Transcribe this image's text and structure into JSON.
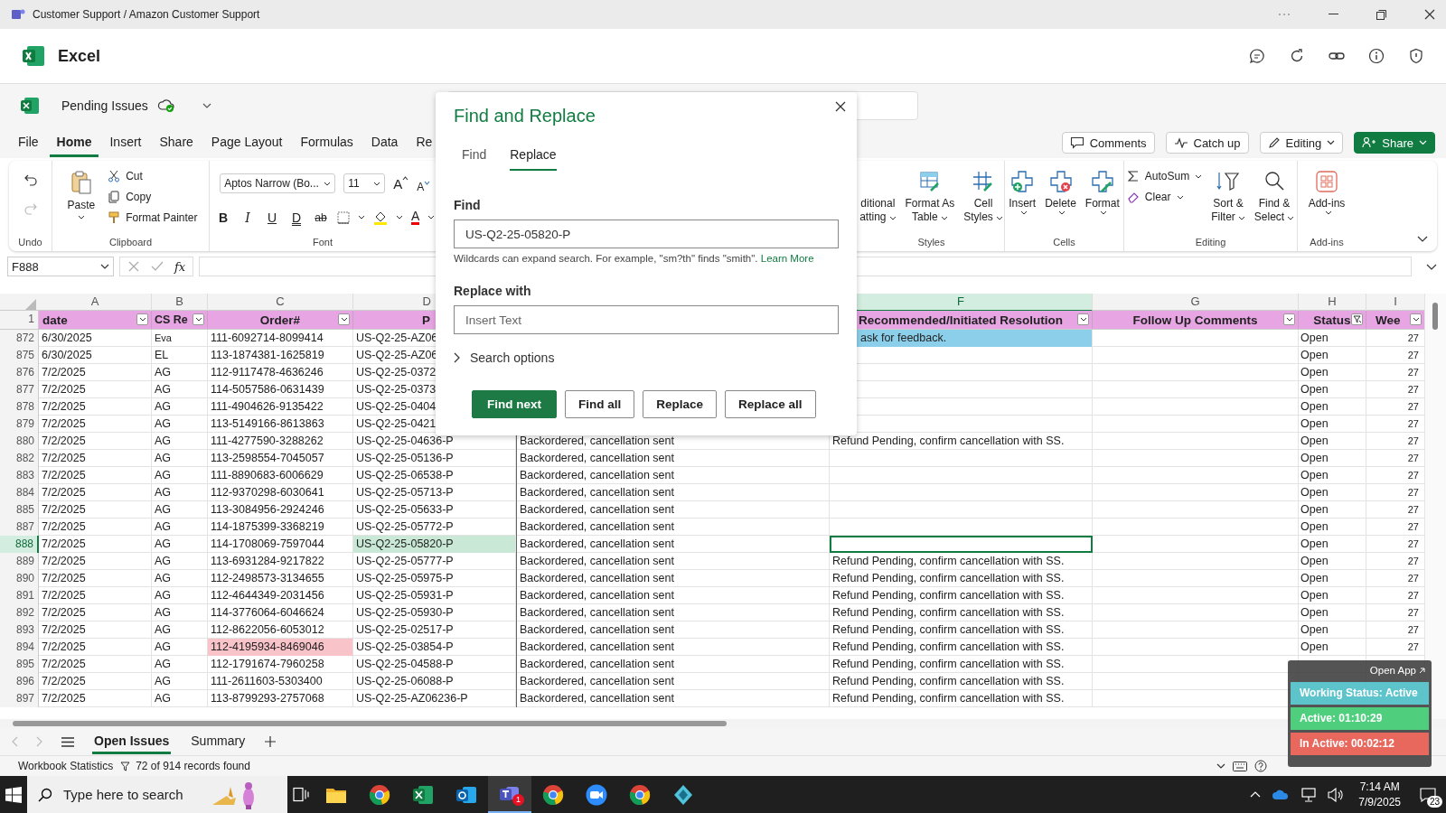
{
  "window": {
    "title": "Customer Support / Amazon Customer Support"
  },
  "app": {
    "name": "Excel"
  },
  "document": {
    "name": "Pending Issues"
  },
  "menu_tabs": [
    {
      "label": "File",
      "selected": false
    },
    {
      "label": "Home",
      "selected": true
    },
    {
      "label": "Insert",
      "selected": false
    },
    {
      "label": "Share",
      "selected": false
    },
    {
      "label": "Page Layout",
      "selected": false
    },
    {
      "label": "Formulas",
      "selected": false
    },
    {
      "label": "Data",
      "selected": false
    },
    {
      "label": "Re",
      "selected": false
    }
  ],
  "header_buttons": [
    {
      "label": "Comments",
      "kind": "comments"
    },
    {
      "label": "Catch up",
      "kind": "catchup"
    },
    {
      "label": "Editing",
      "kind": "editing"
    },
    {
      "label": "Share",
      "kind": "share"
    }
  ],
  "ribbon": {
    "undo": {
      "group": "Undo"
    },
    "clipboard": {
      "group": "Clipboard",
      "paste": "Paste",
      "commands": [
        "Cut",
        "Copy",
        "Format Painter"
      ]
    },
    "font": {
      "group": "Font",
      "family": "Aptos Narrow (Bo...",
      "size": "11",
      "size_buttons": [
        "A",
        "A"
      ],
      "format_buttons": [
        "B",
        "I",
        "U",
        "D",
        "ab"
      ],
      "color_button": "A"
    },
    "styles": {
      "group": "Styles",
      "commands": [
        {
          "line1": "ditional",
          "line2": "atting"
        },
        {
          "line1": "Format As",
          "line2": "Table"
        },
        {
          "line1": "Cell",
          "line2": "Styles"
        }
      ]
    },
    "cells": {
      "group": "Cells",
      "commands": [
        "Insert",
        "Delete",
        "Format"
      ]
    },
    "editing": {
      "group": "Editing",
      "small": [
        "AutoSum",
        "Clear"
      ],
      "large": [
        {
          "line1": "Sort &",
          "line2": "Filter"
        },
        {
          "line1": "Find &",
          "line2": "Select"
        }
      ]
    },
    "addins": {
      "group": "Add-ins",
      "command": "Add-ins"
    }
  },
  "formula_bar": {
    "cell": "F888",
    "function_label": "fx"
  },
  "columns": [
    {
      "letter": "A",
      "header": "date",
      "filtered": false,
      "selected": false
    },
    {
      "letter": "B",
      "header": "CS Re",
      "filtered": false,
      "selected": false
    },
    {
      "letter": "C",
      "header": "Order#",
      "filtered": false,
      "selected": false
    },
    {
      "letter": "D",
      "header": "P",
      "selected": false
    },
    {},
    {
      "letter": "F",
      "header": "Recommended/Initiated Resolution",
      "filtered": false,
      "selected": true
    },
    {
      "letter": "G",
      "header": "Follow Up Comments",
      "filtered": false,
      "selected": false
    },
    {
      "letter": "H",
      "header": "Status",
      "filtered": true,
      "selected": false
    },
    {
      "letter": "I",
      "header": "Wee",
      "filtered": false,
      "selected": false
    }
  ],
  "header_row": {
    "number": "1"
  },
  "rows": [
    {
      "number": "872",
      "selected": false,
      "cells": [
        "6/30/2025",
        "Eva",
        "111-6092714-8099414",
        "US-Q2-25-AZ06",
        null,
        {
          "text": "ask for feedback.",
          "color": "#8ccfea"
        },
        null,
        "Open",
        "27"
      ]
    },
    {
      "number": "875",
      "selected": false,
      "cells": [
        "6/30/2025",
        "EL",
        "113-1874381-1625819",
        "US-Q2-25-AZ06",
        null,
        null,
        null,
        "Open",
        "27"
      ]
    },
    {
      "number": "876",
      "selected": false,
      "cells": [
        "7/2/2025",
        "AG",
        "112-9117478-4636246",
        "US-Q2-25-0372",
        null,
        null,
        null,
        "Open",
        "27"
      ]
    },
    {
      "number": "877",
      "selected": false,
      "cells": [
        "7/2/2025",
        "AG",
        "114-5057586-0631439",
        "US-Q2-25-0373",
        null,
        null,
        null,
        "Open",
        "27"
      ]
    },
    {
      "number": "878",
      "selected": false,
      "cells": [
        "7/2/2025",
        "AG",
        "111-4904626-9135422",
        "US-Q2-25-0404",
        null,
        null,
        null,
        "Open",
        "27"
      ]
    },
    {
      "number": "879",
      "selected": false,
      "cells": [
        "7/2/2025",
        "AG",
        "113-5149166-8613863",
        "US-Q2-25-0421",
        null,
        null,
        null,
        "Open",
        "27"
      ]
    },
    {
      "number": "880",
      "selected": false,
      "cells": [
        "7/2/2025",
        "AG",
        "111-4277590-3288262",
        "US-Q2-25-04636-P",
        "Backordered, cancellation sent",
        "Refund Pending, confirm cancellation with SS.",
        null,
        "Open",
        "27"
      ]
    },
    {
      "number": "882",
      "selected": false,
      "cells": [
        "7/2/2025",
        "AG",
        "113-2598554-7045057",
        "US-Q2-25-05136-P",
        "Backordered, cancellation sent",
        null,
        null,
        "Open",
        "27"
      ]
    },
    {
      "number": "883",
      "selected": false,
      "cells": [
        "7/2/2025",
        "AG",
        "111-8890683-6006629",
        "US-Q2-25-06538-P",
        "Backordered, cancellation sent",
        null,
        null,
        "Open",
        "27"
      ]
    },
    {
      "number": "884",
      "selected": false,
      "cells": [
        "7/2/2025",
        "AG",
        "112-9370298-6030641",
        "US-Q2-25-05713-P",
        "Backordered, cancellation sent",
        null,
        null,
        "Open",
        "27"
      ]
    },
    {
      "number": "885",
      "selected": false,
      "cells": [
        "7/2/2025",
        "AG",
        "113-3084956-2924246",
        "US-Q2-25-05633-P",
        "Backordered, cancellation sent",
        null,
        null,
        "Open",
        "27"
      ]
    },
    {
      "number": "887",
      "selected": false,
      "cells": [
        "7/2/2025",
        "AG",
        "114-1875399-3368219",
        "US-Q2-25-05772-P",
        "Backordered, cancellation sent",
        null,
        null,
        "Open",
        "27"
      ]
    },
    {
      "number": "888",
      "selected": true,
      "cells": [
        "7/2/2025",
        "AG",
        "114-1708069-7597044",
        {
          "text": "US-Q2-25-05820-P",
          "color": "#c9e9d6"
        },
        "Backordered, cancellation sent",
        null,
        null,
        "Open",
        "27"
      ]
    },
    {
      "number": "889",
      "selected": false,
      "cells": [
        "7/2/2025",
        "AG",
        "113-6931284-9217822",
        "US-Q2-25-05777-P",
        "Backordered, cancellation sent",
        "Refund Pending, confirm cancellation with SS.",
        null,
        "Open",
        "27"
      ]
    },
    {
      "number": "890",
      "selected": false,
      "cells": [
        "7/2/2025",
        "AG",
        "112-2498573-3134655",
        "US-Q2-25-05975-P",
        "Backordered, cancellation sent",
        "Refund Pending, confirm cancellation with SS.",
        null,
        "Open",
        "27"
      ]
    },
    {
      "number": "891",
      "selected": false,
      "cells": [
        "7/2/2025",
        "AG",
        "112-4644349-2031456",
        "US-Q2-25-05931-P",
        "Backordered, cancellation sent",
        "Refund Pending, confirm cancellation with SS.",
        null,
        "Open",
        "27"
      ]
    },
    {
      "number": "892",
      "selected": false,
      "cells": [
        "7/2/2025",
        "AG",
        "114-3776064-6046624",
        "US-Q2-25-05930-P",
        "Backordered, cancellation sent",
        "Refund Pending, confirm cancellation with SS.",
        null,
        "Open",
        "27"
      ]
    },
    {
      "number": "893",
      "selected": false,
      "cells": [
        "7/2/2025",
        "AG",
        "112-8622056-6053012",
        "US-Q2-25-02517-P",
        "Backordered, cancellation sent",
        "Refund Pending, confirm cancellation with SS.",
        null,
        "Open",
        "27"
      ]
    },
    {
      "number": "894",
      "selected": false,
      "cells": [
        "7/2/2025",
        "AG",
        {
          "text": "112-4195934-8469046",
          "color": "#f8c3c9"
        },
        "US-Q2-25-03854-P",
        "Backordered, cancellation sent",
        "Refund Pending, confirm cancellation with SS.",
        null,
        "Open",
        "27"
      ]
    },
    {
      "number": "895",
      "selected": false,
      "cells": [
        "7/2/2025",
        "AG",
        "112-1791674-7960258",
        "US-Q2-25-04588-P",
        "Backordered, cancellation sent",
        "Refund Pending, confirm cancellation with SS.",
        null,
        null,
        null
      ]
    },
    {
      "number": "896",
      "selected": false,
      "cells": [
        "7/2/2025",
        "AG",
        "111-2611603-5303400",
        "US-Q2-25-06088-P",
        "Backordered, cancellation sent",
        "Refund Pending, confirm cancellation with SS.",
        null,
        null,
        null
      ]
    },
    {
      "number": "897",
      "selected": false,
      "cells": [
        "7/2/2025",
        "AG",
        "113-8799293-2757068",
        "US-Q2-25-AZ06236-P",
        "Backordered, cancellation sent",
        "Refund Pending, confirm cancellation with SS.",
        null,
        null,
        null
      ]
    }
  ],
  "sheet_tabs": [
    {
      "label": "Open Issues",
      "selected": true
    },
    {
      "label": "Summary",
      "selected": false
    }
  ],
  "status_bar": {
    "left": "Workbook Statistics",
    "filter_count": "72 of 914 records found"
  },
  "dialog": {
    "title": "Find and Replace",
    "tabs": [
      {
        "label": "Find",
        "selected": false
      },
      {
        "label": "Replace",
        "selected": true
      }
    ],
    "find_label": "Find",
    "find_value": "US-Q2-25-05820-P",
    "hint": "Wildcards can expand search. For example, \"sm?th\" finds \"smith\".",
    "hint_link": "Learn More",
    "replace_label": "Replace with",
    "replace_placeholder": "Insert Text",
    "options": "Search options",
    "buttons": [
      {
        "label": "Find next",
        "kind": "primary"
      },
      {
        "label": "Find all",
        "kind": "secondary"
      },
      {
        "label": "Replace",
        "kind": "secondary"
      },
      {
        "label": "Replace all",
        "kind": "secondary"
      }
    ]
  },
  "tracker": {
    "button": "Open App",
    "statuses": [
      {
        "label": "Working Status: Active",
        "color": "#5ec4cc"
      },
      {
        "label": "Active: 01:10:29",
        "color": "#4fcf7d"
      },
      {
        "label": "In Active: 00:02:12",
        "color": "#e9685d"
      }
    ]
  },
  "taskbar": {
    "search_placeholder": "Type here to search",
    "apps": [
      {
        "kind": "folder",
        "active": false
      },
      {
        "kind": "browser",
        "active": false
      },
      {
        "kind": "spreadsheet",
        "active": false
      },
      {
        "kind": "mail",
        "active": false
      },
      {
        "kind": "chat",
        "active": true,
        "badge": "1"
      },
      {
        "kind": "browser",
        "active": false
      },
      {
        "kind": "video",
        "active": false
      },
      {
        "kind": "browser",
        "active": false
      },
      {
        "kind": "diamond",
        "active": false
      }
    ],
    "time": "7:14 AM",
    "date": "7/9/2025",
    "notifications": "23"
  }
}
